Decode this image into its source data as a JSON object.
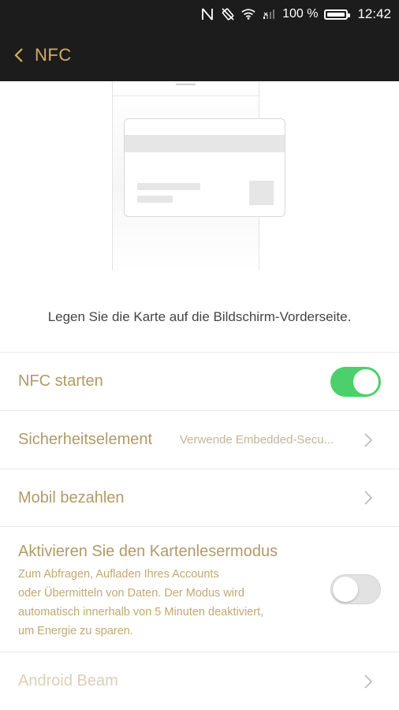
{
  "status_bar": {
    "battery_text": "100 %",
    "time": "12:42"
  },
  "app_bar": {
    "title": "NFC"
  },
  "instruction": "Legen Sie die Karte auf die Bildschirm-Vorderseite.",
  "settings": {
    "nfc_start": {
      "label": "NFC starten",
      "enabled": true
    },
    "secure_element": {
      "label": "Sicherheitselement",
      "value": "Verwende Embedded-Secu..."
    },
    "mobile_pay": {
      "label": "Mobil bezahlen"
    },
    "reader_mode": {
      "label": "Aktivieren Sie den Kartenlesermodus",
      "description": [
        "Zum Abfragen, Aufladen Ihres Accounts",
        "oder Übermitteln von Daten. Der Modus wird",
        "automatisch innerhalb von 5 Minuten deaktiviert,",
        "um Energie zu sparen."
      ],
      "enabled": false
    },
    "android_beam": {
      "label": "Android Beam",
      "disabled": true
    }
  },
  "colors": {
    "accent_gold": "#d4ac66",
    "label_gold": "#b09a66",
    "toggle_on": "#4cd06b",
    "bar_bg": "#1c1c1c"
  },
  "icons": [
    "nfc-icon",
    "rotation-icon",
    "wifi-icon",
    "signal-icon",
    "battery-icon",
    "back-chevron-icon",
    "chevron-right-icon"
  ]
}
